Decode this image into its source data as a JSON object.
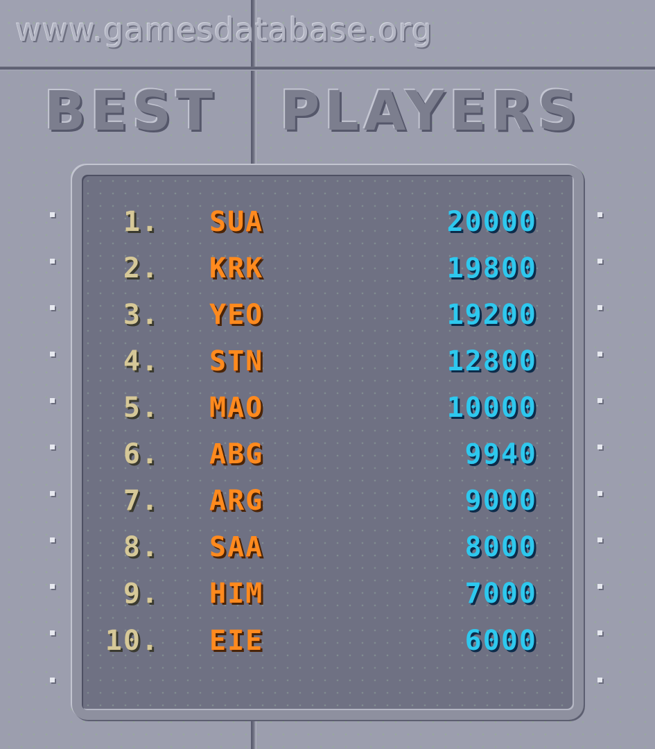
{
  "watermark": "www.gamesdatabase.org",
  "title": {
    "word1": "BEST",
    "word2": "PLAYERS"
  },
  "scoreboard": [
    {
      "rank": "1.",
      "name": "SUA",
      "score": "20000"
    },
    {
      "rank": "2.",
      "name": "KRK",
      "score": "19800"
    },
    {
      "rank": "3.",
      "name": "YEO",
      "score": "19200"
    },
    {
      "rank": "4.",
      "name": "STN",
      "score": "12800"
    },
    {
      "rank": "5.",
      "name": "MAO",
      "score": "10000"
    },
    {
      "rank": "6.",
      "name": "ABG",
      "score": "9940"
    },
    {
      "rank": "7.",
      "name": "ARG",
      "score": "9000"
    },
    {
      "rank": "8.",
      "name": "SAA",
      "score": "8000"
    },
    {
      "rank": "9.",
      "name": "HIM",
      "score": "7000"
    },
    {
      "rank": "10.",
      "name": "EIE",
      "score": "6000"
    }
  ],
  "colors": {
    "rank": "#d6c898",
    "name": "#ff8a1e",
    "score": "#2ec8ee",
    "panel": "#6f7183",
    "background": "#9c9eae"
  }
}
